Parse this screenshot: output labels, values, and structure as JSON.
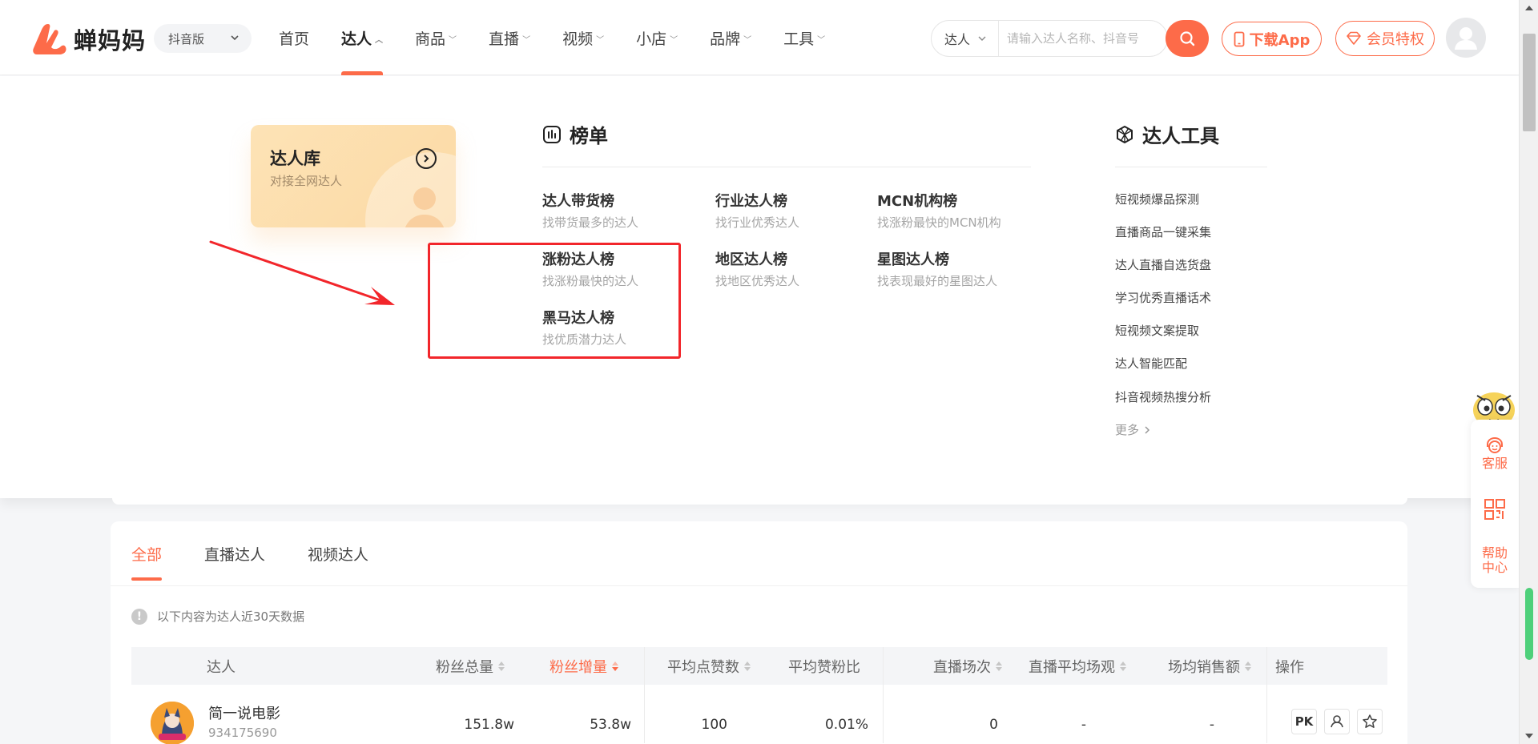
{
  "brand": {
    "name": "蝉妈妈",
    "color": "#fd6b49"
  },
  "version_select": "抖音版",
  "nav": [
    {
      "label": "首页",
      "active": false,
      "caret": false
    },
    {
      "label": "达人",
      "active": true,
      "caret": true
    },
    {
      "label": "商品",
      "active": false,
      "caret": true
    },
    {
      "label": "直播",
      "active": false,
      "caret": true
    },
    {
      "label": "视频",
      "active": false,
      "caret": true
    },
    {
      "label": "小店",
      "active": false,
      "caret": true
    },
    {
      "label": "品牌",
      "active": false,
      "caret": true
    },
    {
      "label": "工具",
      "active": false,
      "caret": true
    }
  ],
  "search": {
    "type": "达人",
    "placeholder": "请输入达人名称、抖音号"
  },
  "header_buttons": {
    "download": "下载App",
    "vip": "会员特权"
  },
  "dropdown": {
    "library": {
      "title": "达人库",
      "subtitle": "对接全网达人"
    },
    "rankings": {
      "title": "榜单",
      "items": [
        {
          "title": "达人带货榜",
          "subtitle": "找带货最多的达人"
        },
        {
          "title": "行业达人榜",
          "subtitle": "找行业优秀达人"
        },
        {
          "title": "MCN机构榜",
          "subtitle": "找涨粉最快的MCN机构"
        },
        {
          "title": "涨粉达人榜",
          "subtitle": "找涨粉最快的达人"
        },
        {
          "title": "地区达人榜",
          "subtitle": "找地区优秀达人"
        },
        {
          "title": "星图达人榜",
          "subtitle": "找表现最好的星图达人"
        },
        {
          "title": "黑马达人榜",
          "subtitle": "找优质潜力达人"
        }
      ]
    },
    "tools": {
      "title": "达人工具",
      "items": [
        "短视频爆品探测",
        "直播商品一键采集",
        "达人直播自选货盘",
        "学习优秀直播话术",
        "短视频文案提取",
        "达人智能匹配",
        "抖音视频热搜分析"
      ],
      "more": "更多"
    }
  },
  "content": {
    "tabs": [
      {
        "label": "全部",
        "active": true
      },
      {
        "label": "直播达人",
        "active": false
      },
      {
        "label": "视频达人",
        "active": false
      }
    ],
    "notice": "以下内容为达人近30天数据",
    "columns": [
      {
        "label": "达人",
        "sort": "none"
      },
      {
        "label": "粉丝总量",
        "sort": "both"
      },
      {
        "label": "粉丝增量",
        "sort": "desc"
      },
      {
        "label": "平均点赞数",
        "sort": "both"
      },
      {
        "label": "平均赞粉比",
        "sort": "none"
      },
      {
        "label": "直播场次",
        "sort": "both"
      },
      {
        "label": "直播平均场观",
        "sort": "both"
      },
      {
        "label": "场均销售额",
        "sort": "both"
      },
      {
        "label": "操作",
        "sort": "none"
      }
    ],
    "rows": [
      {
        "name": "简一说电影",
        "id": "934175690",
        "fans_total": "151.8w",
        "fans_increase": "53.8w",
        "avg_likes": "100",
        "like_fan_ratio": "0.01%",
        "live_count": "0",
        "live_avg_views": "-",
        "avg_sales": "-",
        "op_pk": "PK"
      }
    ]
  },
  "side_panel": {
    "service": "客服",
    "help_line1": "帮助",
    "help_line2": "中心"
  }
}
